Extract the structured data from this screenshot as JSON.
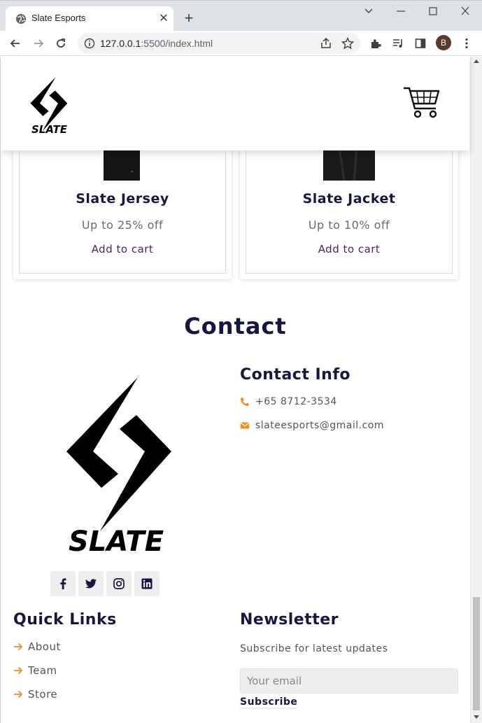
{
  "browser": {
    "tab_title": "Slate Esports",
    "url_host": "127.0.0.1",
    "url_rest": ":5500/index.html",
    "profile_initial": "B"
  },
  "header": {
    "logo_text": "SLATE"
  },
  "products": [
    {
      "title": "Slate Jersey",
      "discount": "Up to 25% off",
      "action": "Add to cart"
    },
    {
      "title": "Slate Jacket",
      "discount": "Up to 10% off",
      "action": "Add to cart"
    }
  ],
  "contact": {
    "heading": "Contact",
    "info_heading": "Contact Info",
    "phone": "+65 8712-3534",
    "email": "slateesports@gmail.com",
    "logo_text": "SLATE"
  },
  "social": [
    "facebook-icon",
    "twitter-icon",
    "instagram-icon",
    "linkedin-icon"
  ],
  "quick_links": {
    "heading": "Quick Links",
    "items": [
      "About",
      "Team",
      "Store"
    ]
  },
  "newsletter": {
    "heading": "Newsletter",
    "subtitle": "Subscribe for latest updates",
    "placeholder": "Your email",
    "button": "Subscribe"
  },
  "colors": {
    "heading": "#141840",
    "accent": "#f28c1e",
    "link": "#4a2366"
  }
}
